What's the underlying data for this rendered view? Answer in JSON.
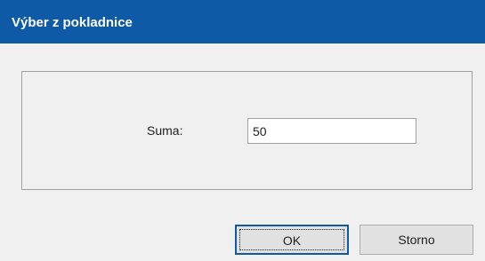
{
  "dialog": {
    "title": "Výber z pokladnice"
  },
  "form": {
    "amount_label": "Suma:",
    "amount_value": "50"
  },
  "buttons": {
    "ok_label": "OK",
    "cancel_label": "Storno"
  },
  "colors": {
    "titlebar": "#0e5aa7",
    "background": "#f0f0f0"
  }
}
